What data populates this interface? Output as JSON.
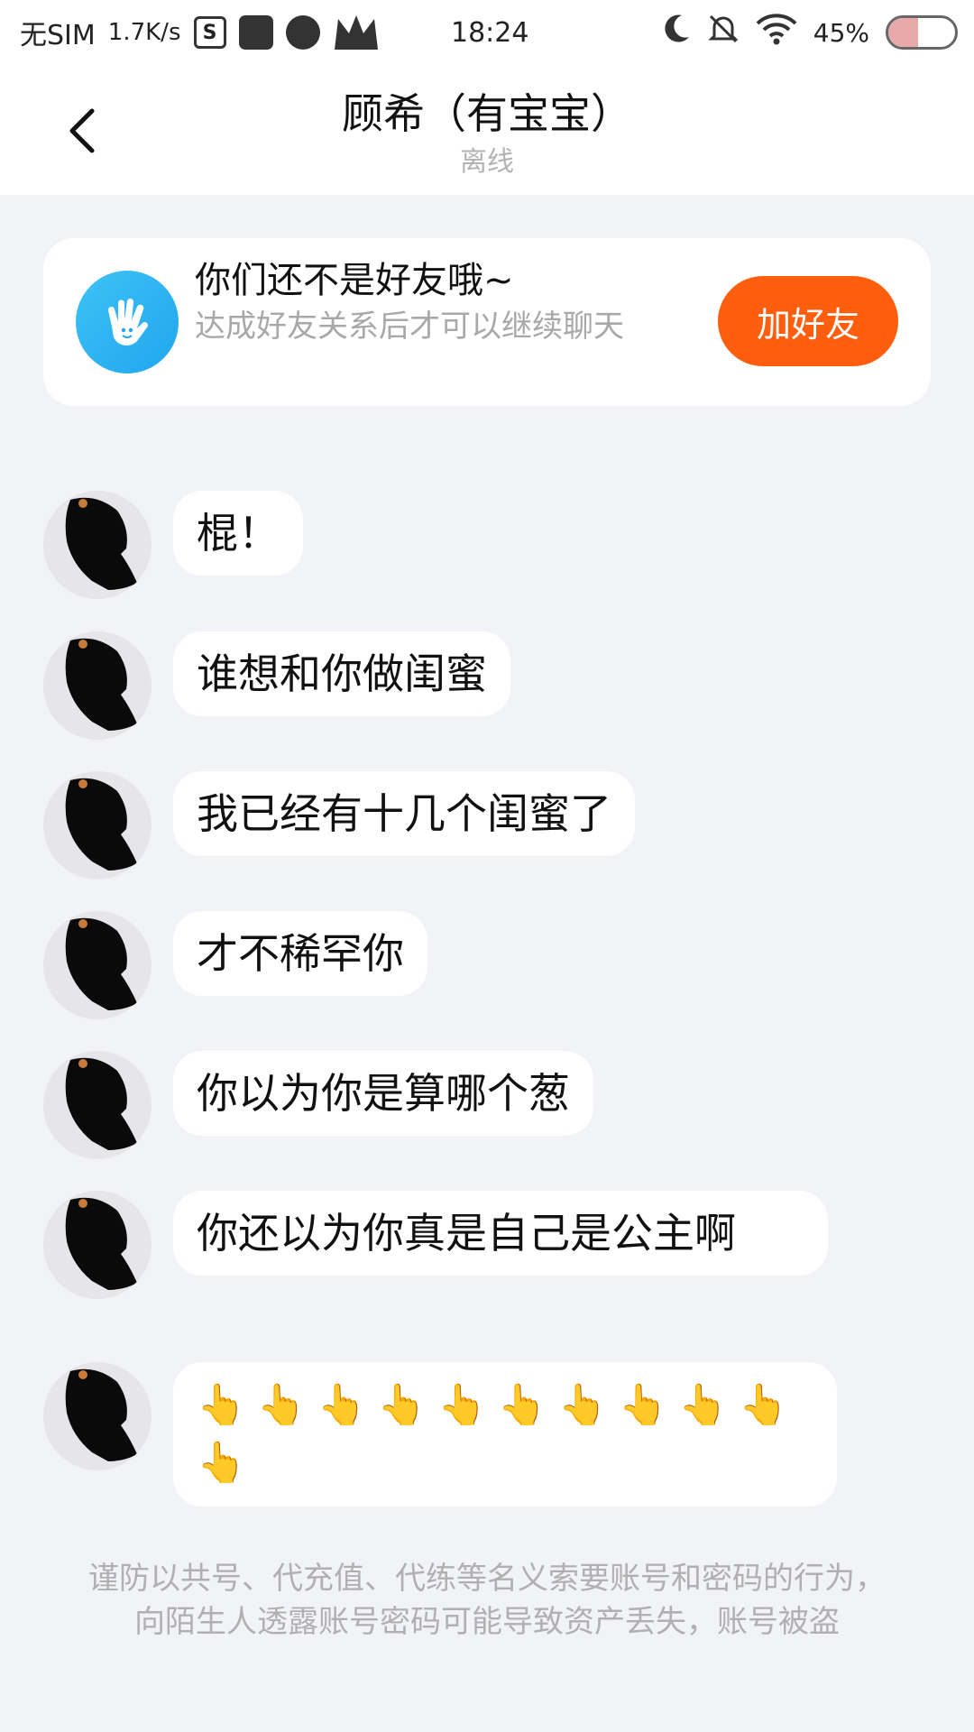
{
  "status_bar": {
    "carrier": "无SIM",
    "speed": "1.7K/s",
    "time": "18:24",
    "battery_text": "45%",
    "battery_level": 0.45
  },
  "header": {
    "title": "顾希（有宝宝）",
    "status": "离线"
  },
  "notice": {
    "title": "你们还不是好友哦~",
    "description": "达成好友关系后才可以继续聊天",
    "button_label": "加好友"
  },
  "messages": [
    {
      "text": "棍！"
    },
    {
      "text": "谁想和你做闺蜜"
    },
    {
      "text": "我已经有十几个闺蜜了"
    },
    {
      "text": "才不稀罕你"
    },
    {
      "text": "你以为你是算哪个葱"
    },
    {
      "text": "你还以为你真是自己是公主啊"
    },
    {
      "text": "👆👆👆👆👆👆👆👆👆👆👆"
    }
  ],
  "footer": {
    "warning": "谨防以共号、代充值、代练等名义索要账号和密码的行为，向陌生人透露账号密码可能导致资产丢失，账号被盗"
  },
  "colors": {
    "accent": "#ff5e0e",
    "background": "#f2f3f7",
    "notice_icon": "#1fa6ee"
  }
}
